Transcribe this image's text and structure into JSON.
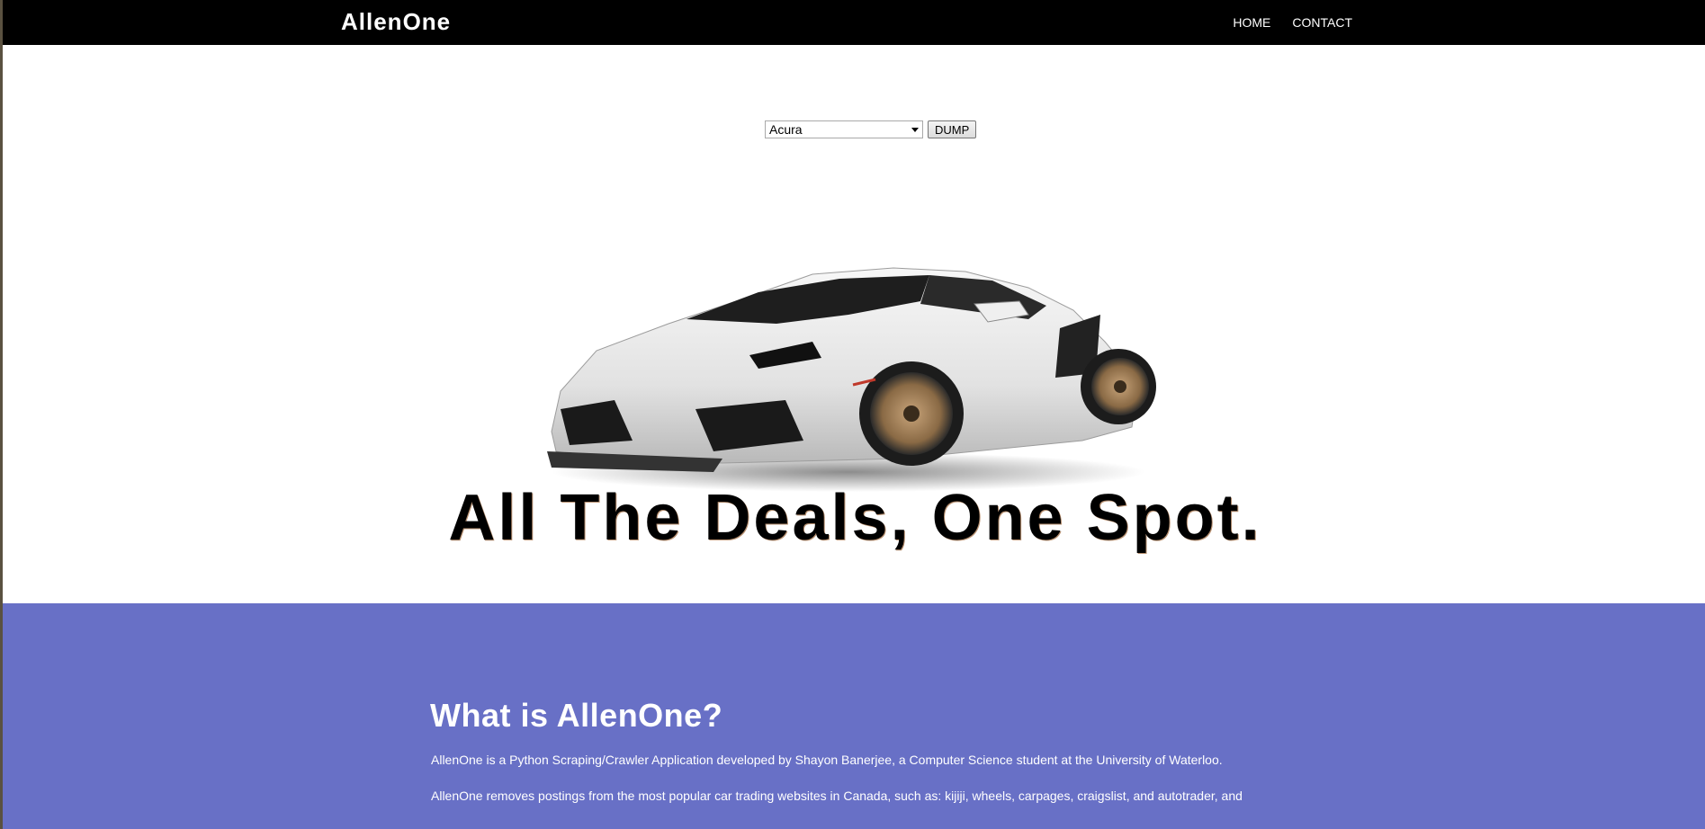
{
  "navbar": {
    "brand": "AllenOne",
    "links": [
      {
        "label": "HOME"
      },
      {
        "label": "CONTACT"
      }
    ]
  },
  "controls": {
    "make_selected": "Acura",
    "dump_label": "DUMP"
  },
  "hero": {
    "image_icon": "sports-car-image",
    "tagline": "All The Deals, One Spot."
  },
  "about": {
    "title": "What is AllenOne?",
    "paragraph1": "AllenOne is a Python Scraping/Crawler Application developed by Shayon Banerjee, a Computer Science student at the University of Waterloo.",
    "paragraph2": "AllenOne removes postings from the most popular car trading websites in Canada, such as: kijiji, wheels, carpages, craigslist, and autotrader, and"
  },
  "colors": {
    "navbar_bg": "#000000",
    "about_bg": "#6870c6",
    "text_light": "#ffffff"
  }
}
